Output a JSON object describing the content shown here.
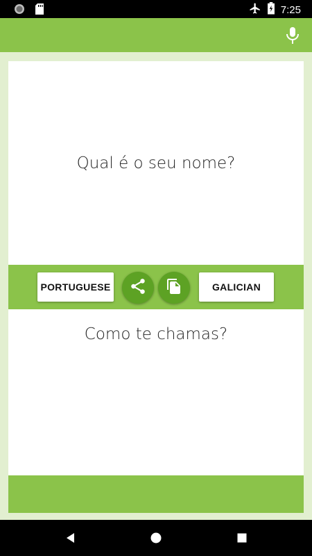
{
  "status_bar": {
    "time": "7:25",
    "left_icons": [
      "notification-circle-icon",
      "sd-card-icon"
    ],
    "right_icons": [
      "airplane-mode-icon",
      "battery-charging-icon"
    ]
  },
  "app_bar": {
    "color": "#8bc34a",
    "action_icon": "microphone-icon"
  },
  "translation": {
    "source_text": "Qual é o seu nome?",
    "target_text": "Como te chamas?"
  },
  "controls": {
    "source_language": "PORTUGUESE",
    "target_language": "GALICIAN",
    "share_icon": "share-icon",
    "copy_icon": "copy-icon",
    "button_color": "#5da224"
  },
  "nav_bar": {
    "icons": [
      "back-icon",
      "home-icon",
      "recents-icon"
    ]
  }
}
